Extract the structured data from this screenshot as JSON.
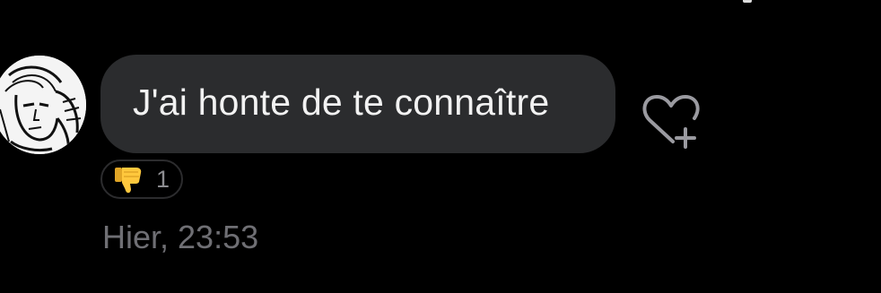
{
  "message": {
    "text": "J'ai honte de te connaître",
    "timestamp": "Hier, 23:53"
  },
  "reaction": {
    "icon": "thumbs-down-emoji",
    "count": "1"
  },
  "actions": {
    "add_reaction_icon": "heart-plus-icon"
  },
  "colors": {
    "background": "#000000",
    "bubble": "#2b2c2e",
    "bubble_text": "#f2f2f2",
    "meta_text": "#6f6f74",
    "emoji": "#ffc83d"
  }
}
